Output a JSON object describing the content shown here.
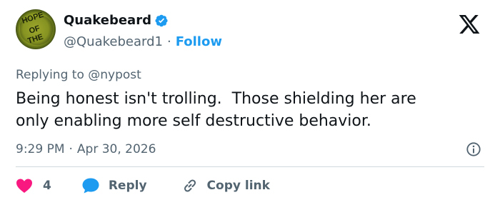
{
  "author": {
    "display_name": "Quakebeard",
    "handle": "@Quakebeard1",
    "separator": "·",
    "follow_label": "Follow",
    "avatar_text": [
      "HOPE",
      "OF",
      "THE"
    ],
    "verified_color": "#1d9bf0"
  },
  "platform": {
    "logo_icon": "x-logo-icon"
  },
  "reply_context": {
    "prefix": "Replying to",
    "mention": "@nypost"
  },
  "tweet": {
    "text": "Being honest isn't trolling.  Those shielding her are\nonly enabling more self destructive behavior.",
    "time": "9:29 PM",
    "separator": "·",
    "date": "Apr 30, 2026"
  },
  "actions": {
    "like_count": "4",
    "reply_label": "Reply",
    "copy_link_label": "Copy link"
  },
  "colors": {
    "text": "#0f1419",
    "secondary": "#536471",
    "accent": "#1d9bf0",
    "like": "#f91880",
    "divider": "#cfd9de"
  }
}
